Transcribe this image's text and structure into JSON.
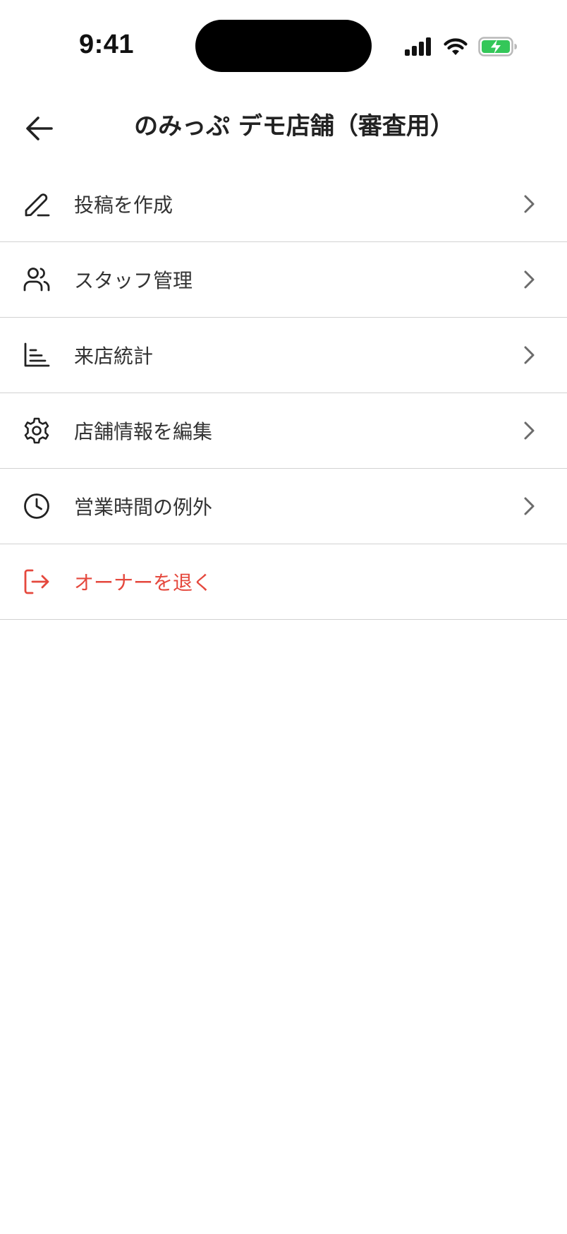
{
  "status_bar": {
    "time": "9:41",
    "battery_color": "#34c759"
  },
  "header": {
    "title": "のみっぷ デモ店舗（審査用）",
    "back_icon": "arrow-left-icon"
  },
  "menu": {
    "items": [
      {
        "label": "投稿を作成",
        "icon": "pencil-icon"
      },
      {
        "label": "スタッフ管理",
        "icon": "users-icon"
      },
      {
        "label": "来店統計",
        "icon": "chart-icon"
      },
      {
        "label": "店舗情報を編集",
        "icon": "gear-icon"
      },
      {
        "label": "営業時間の例外",
        "icon": "clock-icon"
      },
      {
        "label": "オーナーを退く",
        "icon": "logout-icon",
        "color": "#e5483d"
      }
    ]
  }
}
